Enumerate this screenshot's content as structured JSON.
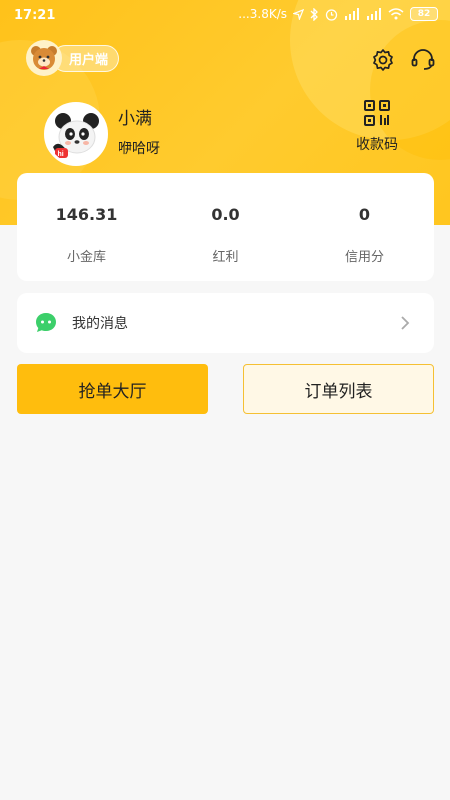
{
  "status_bar": {
    "time": "17:21",
    "network_speed": "...3.8K/s",
    "battery": "82"
  },
  "header": {
    "role_label": "用户端",
    "settings_icon": "gear-icon",
    "support_icon": "headset-icon"
  },
  "profile": {
    "username": "小满",
    "bio": "咿哈呀",
    "qr_label": "收款码"
  },
  "stats": [
    {
      "value": "146.31",
      "label": "小金库"
    },
    {
      "value": "0.0",
      "label": "红利"
    },
    {
      "value": "0",
      "label": "信用分"
    }
  ],
  "messages": {
    "label": "我的消息"
  },
  "actions": {
    "grab_orders": "抢单大厅",
    "order_list": "订单列表"
  },
  "colors": {
    "accent": "#ffbd0d",
    "header": "#ffc61f",
    "background": "#f7f7f7"
  }
}
